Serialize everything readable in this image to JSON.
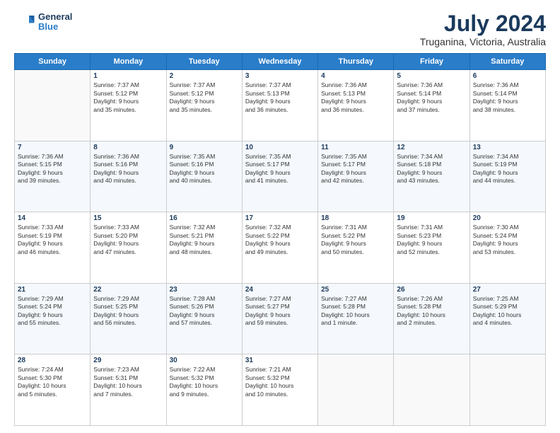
{
  "logo": {
    "line1": "General",
    "line2": "Blue"
  },
  "title": "July 2024",
  "subtitle": "Truganina, Victoria, Australia",
  "weekdays": [
    "Sunday",
    "Monday",
    "Tuesday",
    "Wednesday",
    "Thursday",
    "Friday",
    "Saturday"
  ],
  "weeks": [
    [
      {
        "day": "",
        "info": ""
      },
      {
        "day": "1",
        "info": "Sunrise: 7:37 AM\nSunset: 5:12 PM\nDaylight: 9 hours\nand 35 minutes."
      },
      {
        "day": "2",
        "info": "Sunrise: 7:37 AM\nSunset: 5:12 PM\nDaylight: 9 hours\nand 35 minutes."
      },
      {
        "day": "3",
        "info": "Sunrise: 7:37 AM\nSunset: 5:13 PM\nDaylight: 9 hours\nand 36 minutes."
      },
      {
        "day": "4",
        "info": "Sunrise: 7:36 AM\nSunset: 5:13 PM\nDaylight: 9 hours\nand 36 minutes."
      },
      {
        "day": "5",
        "info": "Sunrise: 7:36 AM\nSunset: 5:14 PM\nDaylight: 9 hours\nand 37 minutes."
      },
      {
        "day": "6",
        "info": "Sunrise: 7:36 AM\nSunset: 5:14 PM\nDaylight: 9 hours\nand 38 minutes."
      }
    ],
    [
      {
        "day": "7",
        "info": "Sunrise: 7:36 AM\nSunset: 5:15 PM\nDaylight: 9 hours\nand 39 minutes."
      },
      {
        "day": "8",
        "info": "Sunrise: 7:36 AM\nSunset: 5:16 PM\nDaylight: 9 hours\nand 40 minutes."
      },
      {
        "day": "9",
        "info": "Sunrise: 7:35 AM\nSunset: 5:16 PM\nDaylight: 9 hours\nand 40 minutes."
      },
      {
        "day": "10",
        "info": "Sunrise: 7:35 AM\nSunset: 5:17 PM\nDaylight: 9 hours\nand 41 minutes."
      },
      {
        "day": "11",
        "info": "Sunrise: 7:35 AM\nSunset: 5:17 PM\nDaylight: 9 hours\nand 42 minutes."
      },
      {
        "day": "12",
        "info": "Sunrise: 7:34 AM\nSunset: 5:18 PM\nDaylight: 9 hours\nand 43 minutes."
      },
      {
        "day": "13",
        "info": "Sunrise: 7:34 AM\nSunset: 5:19 PM\nDaylight: 9 hours\nand 44 minutes."
      }
    ],
    [
      {
        "day": "14",
        "info": "Sunrise: 7:33 AM\nSunset: 5:19 PM\nDaylight: 9 hours\nand 46 minutes."
      },
      {
        "day": "15",
        "info": "Sunrise: 7:33 AM\nSunset: 5:20 PM\nDaylight: 9 hours\nand 47 minutes."
      },
      {
        "day": "16",
        "info": "Sunrise: 7:32 AM\nSunset: 5:21 PM\nDaylight: 9 hours\nand 48 minutes."
      },
      {
        "day": "17",
        "info": "Sunrise: 7:32 AM\nSunset: 5:22 PM\nDaylight: 9 hours\nand 49 minutes."
      },
      {
        "day": "18",
        "info": "Sunrise: 7:31 AM\nSunset: 5:22 PM\nDaylight: 9 hours\nand 50 minutes."
      },
      {
        "day": "19",
        "info": "Sunrise: 7:31 AM\nSunset: 5:23 PM\nDaylight: 9 hours\nand 52 minutes."
      },
      {
        "day": "20",
        "info": "Sunrise: 7:30 AM\nSunset: 5:24 PM\nDaylight: 9 hours\nand 53 minutes."
      }
    ],
    [
      {
        "day": "21",
        "info": "Sunrise: 7:29 AM\nSunset: 5:24 PM\nDaylight: 9 hours\nand 55 minutes."
      },
      {
        "day": "22",
        "info": "Sunrise: 7:29 AM\nSunset: 5:25 PM\nDaylight: 9 hours\nand 56 minutes."
      },
      {
        "day": "23",
        "info": "Sunrise: 7:28 AM\nSunset: 5:26 PM\nDaylight: 9 hours\nand 57 minutes."
      },
      {
        "day": "24",
        "info": "Sunrise: 7:27 AM\nSunset: 5:27 PM\nDaylight: 9 hours\nand 59 minutes."
      },
      {
        "day": "25",
        "info": "Sunrise: 7:27 AM\nSunset: 5:28 PM\nDaylight: 10 hours\nand 1 minute."
      },
      {
        "day": "26",
        "info": "Sunrise: 7:26 AM\nSunset: 5:28 PM\nDaylight: 10 hours\nand 2 minutes."
      },
      {
        "day": "27",
        "info": "Sunrise: 7:25 AM\nSunset: 5:29 PM\nDaylight: 10 hours\nand 4 minutes."
      }
    ],
    [
      {
        "day": "28",
        "info": "Sunrise: 7:24 AM\nSunset: 5:30 PM\nDaylight: 10 hours\nand 5 minutes."
      },
      {
        "day": "29",
        "info": "Sunrise: 7:23 AM\nSunset: 5:31 PM\nDaylight: 10 hours\nand 7 minutes."
      },
      {
        "day": "30",
        "info": "Sunrise: 7:22 AM\nSunset: 5:32 PM\nDaylight: 10 hours\nand 9 minutes."
      },
      {
        "day": "31",
        "info": "Sunrise: 7:21 AM\nSunset: 5:32 PM\nDaylight: 10 hours\nand 10 minutes."
      },
      {
        "day": "",
        "info": ""
      },
      {
        "day": "",
        "info": ""
      },
      {
        "day": "",
        "info": ""
      }
    ]
  ]
}
